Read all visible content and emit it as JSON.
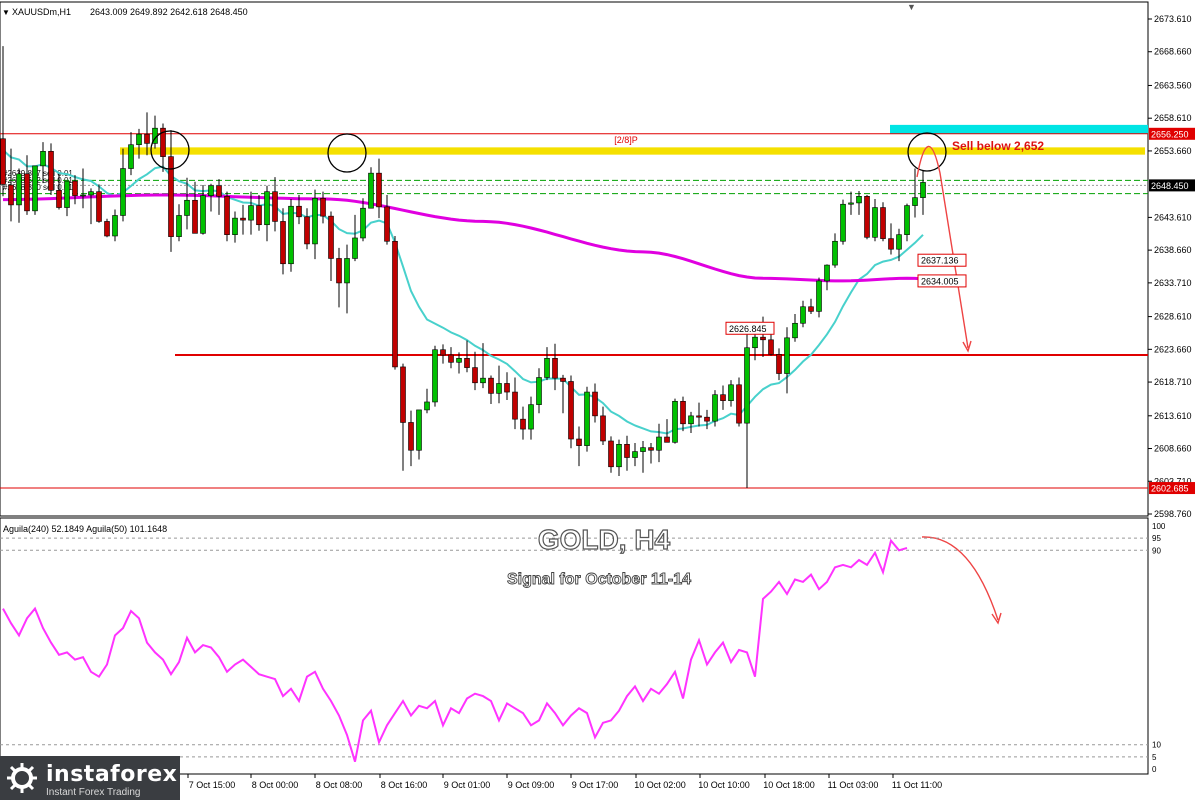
{
  "header": {
    "symbol": "XAUUSDm,H1",
    "ohlc": "2643.009 2649.892 2642.618 2648.450",
    "hidden_lines": [
      "#2639.857 sell 0.01",
      "#2638.612 sell 0.01",
      "#2638.870 sell 0.01"
    ]
  },
  "overlay": {
    "title": "GOLD, H4",
    "subtitle": "Signal for October 11-14",
    "level_label": "[2/8]P",
    "sell_label": "Sell below 2,652"
  },
  "price_axis": {
    "ticks": [
      "2673.610",
      "2668.660",
      "2663.560",
      "2658.610",
      "2653.660",
      "2648.450",
      "2643.610",
      "2638.660",
      "2633.710",
      "2628.610",
      "2623.660",
      "2618.710",
      "2613.610",
      "2608.660",
      "2603.710",
      "2598.760"
    ]
  },
  "badges": {
    "top_level": "2656.250",
    "current": "2648.450",
    "ma_fast": "2637.136",
    "ma_slow": "2634.005",
    "mid_label": "2626.845",
    "bottom_level": "2602.685"
  },
  "indicator": {
    "label": "Aguila(240) 52.1849  Aguila(50) 101.1648",
    "levels": [
      "100",
      "95",
      "90",
      "10",
      "5",
      "0"
    ]
  },
  "time_axis": {
    "labels": [
      "7 Oct 15:00",
      "8 Oct 00:00",
      "8 Oct 08:00",
      "8 Oct 16:00",
      "9 Oct 01:00",
      "9 Oct 09:00",
      "9 Oct 17:00",
      "10 Oct 02:00",
      "10 Oct 10:00",
      "10 Oct 18:00",
      "11 Oct 03:00",
      "11 Oct 11:00"
    ]
  },
  "logo": {
    "name": "instaforex",
    "tagline": "Instant Forex Trading"
  },
  "colors": {
    "up": "#00c000",
    "down": "#c00000",
    "ma_fast": "#48d1cc",
    "ma_slow": "#e000e0",
    "resistance_band": "#f5e000",
    "cyan_zone": "#00e5e5",
    "level_line": "#e00000",
    "rsi_line": "#ff33ff",
    "grid_dash": "#00a000"
  },
  "chart_data": {
    "type": "candlestick",
    "symbol": "XAUUSDm",
    "timeframe": "H1",
    "ylim": [
      2598.76,
      2675.5
    ],
    "x_labels": [
      "7 Oct 15:00",
      "8 Oct 00:00",
      "8 Oct 08:00",
      "8 Oct 16:00",
      "9 Oct 01:00",
      "9 Oct 09:00",
      "9 Oct 17:00",
      "10 Oct 02:00",
      "10 Oct 10:00",
      "10 Oct 18:00",
      "11 Oct 03:00",
      "11 Oct 11:00"
    ],
    "candles": [
      [
        2655.5,
        2669.5,
        2646.8,
        2648.6
      ],
      [
        2648.5,
        2654.0,
        2643.0,
        2645.5
      ],
      [
        2645.5,
        2651.0,
        2642.8,
        2650.2
      ],
      [
        2650.2,
        2653.0,
        2644.0,
        2644.6
      ],
      [
        2644.6,
        2651.2,
        2644.0,
        2651.4
      ],
      [
        2651.4,
        2655.0,
        2648.8,
        2653.6
      ],
      [
        2653.6,
        2654.8,
        2647.0,
        2647.7
      ],
      [
        2647.7,
        2650.2,
        2644.8,
        2645.1
      ],
      [
        2645.1,
        2649.0,
        2643.8,
        2649.1
      ],
      [
        2649.1,
        2650.0,
        2645.6,
        2646.9
      ],
      [
        2646.9,
        2651.0,
        2645.0,
        2647.0
      ],
      [
        2647.0,
        2648.0,
        2642.6,
        2647.5
      ],
      [
        2647.5,
        2648.6,
        2642.8,
        2643.0
      ],
      [
        2643.0,
        2643.4,
        2640.6,
        2640.8
      ],
      [
        2640.8,
        2644.8,
        2640.0,
        2643.9
      ],
      [
        2643.9,
        2654.0,
        2643.0,
        2651.0
      ],
      [
        2651.0,
        2656.5,
        2650.0,
        2654.6
      ],
      [
        2654.6,
        2657.0,
        2652.5,
        2656.2
      ],
      [
        2656.2,
        2659.5,
        2653.0,
        2654.8
      ],
      [
        2654.8,
        2659.0,
        2654.0,
        2657.1
      ],
      [
        2657.1,
        2657.8,
        2650.5,
        2652.8
      ],
      [
        2652.8,
        2656.8,
        2638.4,
        2640.7
      ],
      [
        2640.7,
        2645.6,
        2640.0,
        2643.9
      ],
      [
        2643.9,
        2649.6,
        2641.8,
        2646.2
      ],
      [
        2646.2,
        2649.0,
        2643.0,
        2641.2
      ],
      [
        2641.2,
        2648.5,
        2641.0,
        2646.9
      ],
      [
        2646.9,
        2648.7,
        2644.5,
        2648.4
      ],
      [
        2648.4,
        2649.4,
        2644.0,
        2646.8
      ],
      [
        2646.8,
        2647.5,
        2640.0,
        2641.0
      ],
      [
        2641.0,
        2644.5,
        2639.8,
        2643.5
      ],
      [
        2643.5,
        2645.5,
        2641.0,
        2643.2
      ],
      [
        2643.2,
        2647.5,
        2641.0,
        2645.4
      ],
      [
        2645.4,
        2647.0,
        2641.6,
        2642.5
      ],
      [
        2642.5,
        2648.4,
        2640.0,
        2647.5
      ],
      [
        2647.5,
        2649.7,
        2641.5,
        2643.0
      ],
      [
        2643.0,
        2645.0,
        2635.0,
        2636.6
      ],
      [
        2636.6,
        2646.4,
        2635.4,
        2645.3
      ],
      [
        2645.3,
        2647.0,
        2642.6,
        2643.7
      ],
      [
        2643.7,
        2645.0,
        2638.8,
        2639.6
      ],
      [
        2639.6,
        2647.8,
        2637.3,
        2646.5
      ],
      [
        2646.5,
        2647.5,
        2642.7,
        2643.8
      ],
      [
        2643.8,
        2644.5,
        2634.0,
        2637.4
      ],
      [
        2637.4,
        2639.0,
        2630.0,
        2633.7
      ],
      [
        2633.7,
        2639.5,
        2629.1,
        2637.4
      ],
      [
        2637.4,
        2644.0,
        2637.0,
        2640.5
      ],
      [
        2640.5,
        2646.5,
        2640.0,
        2645.0
      ],
      [
        2645.0,
        2651.2,
        2645.0,
        2650.3
      ],
      [
        2650.3,
        2652.5,
        2643.5,
        2645.2
      ],
      [
        2645.2,
        2647.0,
        2639.5,
        2640.0
      ],
      [
        2640.0,
        2640.8,
        2620.6,
        2621.0
      ],
      [
        2621.0,
        2621.5,
        2605.3,
        2612.6
      ],
      [
        2612.6,
        2614.4,
        2606.0,
        2608.4
      ],
      [
        2608.4,
        2614.4,
        2607.0,
        2614.5
      ],
      [
        2614.5,
        2617.7,
        2614.0,
        2615.7
      ],
      [
        2615.7,
        2624.2,
        2615.0,
        2623.6
      ],
      [
        2623.6,
        2624.4,
        2621.5,
        2622.8
      ],
      [
        2622.8,
        2624.0,
        2620.8,
        2621.7
      ],
      [
        2621.7,
        2623.2,
        2620.0,
        2622.3
      ],
      [
        2622.3,
        2625.0,
        2620.2,
        2620.9
      ],
      [
        2620.9,
        2623.3,
        2617.5,
        2618.6
      ],
      [
        2618.6,
        2624.6,
        2617.8,
        2619.3
      ],
      [
        2619.3,
        2619.7,
        2615.4,
        2617.0
      ],
      [
        2617.0,
        2621.2,
        2615.5,
        2618.5
      ],
      [
        2618.5,
        2620.2,
        2616.0,
        2617.2
      ],
      [
        2617.2,
        2619.4,
        2611.6,
        2613.1
      ],
      [
        2613.1,
        2615.0,
        2610.0,
        2611.6
      ],
      [
        2611.6,
        2616.5,
        2610.0,
        2615.3
      ],
      [
        2615.3,
        2620.8,
        2614.0,
        2619.4
      ],
      [
        2619.4,
        2624.0,
        2619.0,
        2622.3
      ],
      [
        2622.3,
        2624.5,
        2617.5,
        2619.3
      ],
      [
        2619.3,
        2619.8,
        2614.0,
        2618.8
      ],
      [
        2618.8,
        2619.7,
        2608.7,
        2610.1
      ],
      [
        2610.1,
        2612.0,
        2606.0,
        2609.1
      ],
      [
        2609.1,
        2618.0,
        2608.2,
        2617.2
      ],
      [
        2617.2,
        2618.5,
        2612.6,
        2613.6
      ],
      [
        2613.6,
        2615.0,
        2609.2,
        2609.8
      ],
      [
        2609.8,
        2610.5,
        2605.0,
        2605.9
      ],
      [
        2605.9,
        2610.0,
        2604.5,
        2609.3
      ],
      [
        2609.3,
        2610.6,
        2605.3,
        2607.3
      ],
      [
        2607.3,
        2609.5,
        2606.0,
        2608.2
      ],
      [
        2608.2,
        2609.8,
        2605.0,
        2608.8
      ],
      [
        2608.8,
        2609.5,
        2606.4,
        2608.4
      ],
      [
        2608.4,
        2612.4,
        2606.6,
        2610.4
      ],
      [
        2610.4,
        2613.1,
        2609.6,
        2609.6
      ],
      [
        2609.6,
        2616.2,
        2609.4,
        2615.8
      ],
      [
        2615.8,
        2616.5,
        2611.3,
        2612.4
      ],
      [
        2612.4,
        2614.2,
        2611.0,
        2613.6
      ],
      [
        2613.6,
        2615.6,
        2612.0,
        2613.4
      ],
      [
        2613.4,
        2614.5,
        2611.6,
        2612.8
      ],
      [
        2612.8,
        2617.5,
        2612.0,
        2616.8
      ],
      [
        2616.8,
        2618.2,
        2614.5,
        2615.9
      ],
      [
        2615.9,
        2619.0,
        2615.0,
        2618.3
      ],
      [
        2618.3,
        2619.4,
        2612.0,
        2612.5
      ],
      [
        2612.5,
        2627.8,
        2602.7,
        2623.9
      ],
      [
        2623.9,
        2627.0,
        2622.0,
        2625.5
      ],
      [
        2625.5,
        2628.6,
        2622.5,
        2625.1
      ],
      [
        2625.1,
        2627.6,
        2622.7,
        2622.9
      ],
      [
        2622.9,
        2623.8,
        2619.0,
        2620.0
      ],
      [
        2620.0,
        2627.0,
        2617.0,
        2625.4
      ],
      [
        2625.4,
        2629.0,
        2624.8,
        2627.6
      ],
      [
        2627.6,
        2631.0,
        2627.0,
        2630.1
      ],
      [
        2630.1,
        2631.3,
        2629.0,
        2629.4
      ],
      [
        2629.4,
        2634.5,
        2628.5,
        2634.0
      ],
      [
        2634.0,
        2636.5,
        2632.6,
        2636.4
      ],
      [
        2636.4,
        2641.2,
        2636.0,
        2640.0
      ],
      [
        2640.0,
        2646.3,
        2639.5,
        2645.6
      ],
      [
        2645.6,
        2647.5,
        2644.0,
        2645.8
      ],
      [
        2645.8,
        2647.6,
        2644.0,
        2646.8
      ],
      [
        2646.8,
        2647.0,
        2640.3,
        2640.6
      ],
      [
        2640.6,
        2646.4,
        2640.0,
        2645.1
      ],
      [
        2645.1,
        2645.9,
        2640.0,
        2640.4
      ],
      [
        2640.4,
        2642.7,
        2638.0,
        2638.8
      ],
      [
        2638.8,
        2641.9,
        2637.0,
        2641.0
      ],
      [
        2641.0,
        2645.7,
        2640.0,
        2645.4
      ],
      [
        2645.4,
        2651.0,
        2643.6,
        2646.6
      ],
      [
        2646.6,
        2650.8,
        2644.0,
        2648.9
      ]
    ],
    "overlays": {
      "ma_fast_last": 2637.136,
      "ma_slow_last": 2634.005,
      "resistance_band": [
        2653.4,
        2654.2
      ],
      "cyan_zone": [
        2656.25,
        2657.6
      ],
      "level_top": 2656.25,
      "level_mid": 2622.8,
      "level_bottom": 2602.685,
      "sell_level": 2652
    },
    "indicator": {
      "name": "Aguila",
      "ylim": [
        0,
        100
      ],
      "levels": [
        100,
        95,
        90,
        10,
        5,
        0
      ],
      "values": [
        66,
        60,
        55,
        62,
        66,
        58,
        52,
        47,
        48,
        45,
        46,
        40,
        38,
        43,
        55,
        58,
        65,
        62,
        52,
        48,
        45,
        39,
        44,
        54,
        48,
        51,
        50,
        46,
        40,
        43,
        45,
        42,
        39,
        38,
        37,
        30,
        33,
        28,
        38,
        40,
        33,
        28,
        22,
        14,
        3,
        20,
        24,
        11,
        18,
        23,
        28,
        22,
        26,
        25,
        28,
        18,
        25,
        23,
        29,
        31,
        30,
        28,
        20,
        27,
        25,
        23,
        18,
        20,
        27,
        23,
        18,
        22,
        25,
        23,
        13,
        19,
        20,
        24,
        30,
        34,
        28,
        33,
        31,
        35,
        40,
        29,
        45,
        53,
        43,
        48,
        52,
        44,
        49,
        48,
        38,
        70,
        73,
        77,
        72,
        78,
        77,
        80,
        74,
        77,
        83,
        84,
        83,
        86,
        84,
        89,
        81,
        94,
        90,
        91
      ]
    },
    "annotations": [
      "[2/8]P",
      "Sell below 2,652",
      "GOLD, H4",
      "Signal for October 11-14"
    ]
  }
}
